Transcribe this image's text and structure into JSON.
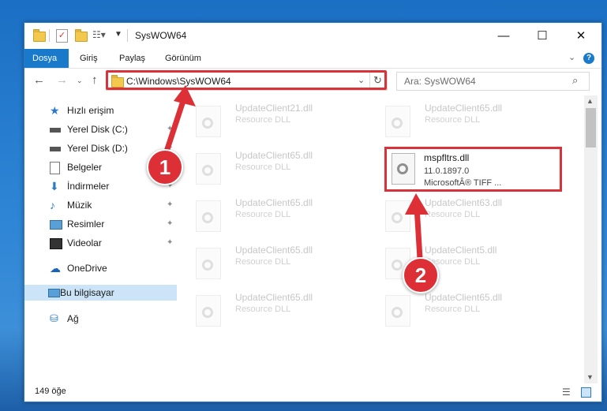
{
  "window": {
    "title": "SysWOW64"
  },
  "ribbon": {
    "tabs": [
      {
        "label": "Dosya"
      },
      {
        "label": "Giriş"
      },
      {
        "label": "Paylaş"
      },
      {
        "label": "Görünüm"
      }
    ]
  },
  "address": {
    "path": "C:\\Windows\\SysWOW64"
  },
  "search": {
    "placeholder": "Ara: SysWOW64"
  },
  "sidebar": {
    "items": [
      {
        "label": "Hızlı erişim"
      },
      {
        "label": "Yerel Disk (C:)"
      },
      {
        "label": "Yerel Disk (D:)"
      },
      {
        "label": "Belgeler"
      },
      {
        "label": "İndirmeler"
      },
      {
        "label": "Müzik"
      },
      {
        "label": "Resimler"
      },
      {
        "label": "Videolar"
      },
      {
        "label": "OneDrive"
      },
      {
        "label": "Bu bilgisayar"
      },
      {
        "label": "Ağ"
      }
    ]
  },
  "files": [
    {
      "name": "UpdateClient21.dll",
      "type": "Resource DLL"
    },
    {
      "name": "UpdateClient65.dll",
      "type": "Resource DLL"
    },
    {
      "name": "UpdateClient65.dll",
      "type": "Resource DLL"
    },
    {
      "name": "UpdateClient65.dll",
      "type": "Resource DLL"
    },
    {
      "name": "UpdateClient63.dll",
      "type": "Resource DLL"
    },
    {
      "name": "UpdateClient65.dll",
      "type": "Resource DLL"
    },
    {
      "name": "UpdateClient5.dll",
      "type": "Resource DLL"
    },
    {
      "name": "UpdateClient65.dll",
      "type": "Resource DLL"
    },
    {
      "name": "UpdateClient65.dll",
      "type": "Resource DLL"
    }
  ],
  "highlighted_file": {
    "name": "mspfltrs.dll",
    "version": "11.0.1897.0",
    "company": "MicrosoftÂ® TIFF ..."
  },
  "status": {
    "count": "149 öğe"
  },
  "badges": {
    "one": "1",
    "two": "2"
  },
  "colors": {
    "accent": "#1979ca",
    "highlight": "#d8333a"
  }
}
